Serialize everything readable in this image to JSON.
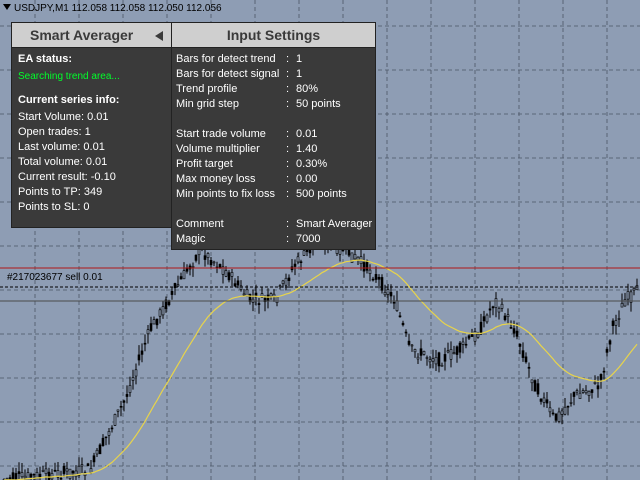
{
  "chart": {
    "symbol_header": "USDJPY,M1  112.058 112.058 112.050 112.056",
    "order_label": "#217023677 sell 0.01",
    "colors": {
      "background": "#8e9db4",
      "grid": "#4b5566",
      "candle": "#000000",
      "moving_average": "#e8d44a",
      "order_line": "#b01818"
    }
  },
  "ea_panel": {
    "title": "Smart Averager",
    "collapse_icon": "triangle-left-icon",
    "status_heading": "EA status:",
    "status_text": "Searching trend area...",
    "series_heading": "Current series info:",
    "lines": [
      "Start Volume: 0.01",
      "Open trades: 1",
      "Last volume: 0.01",
      "Total volume: 0.01",
      "Current result: -0.10",
      "Points to TP: 349",
      "Points to SL: 0"
    ]
  },
  "input_panel": {
    "title": "Input Settings",
    "settings": [
      {
        "label": "Bars for detect trend",
        "value": "1"
      },
      {
        "label": "Bars for detect signal",
        "value": "1"
      },
      {
        "label": "Trend profile",
        "value": "80%"
      },
      {
        "label": "Min grid step",
        "value": "50 points"
      },
      {
        "label": "",
        "value": ""
      },
      {
        "label": "Start trade volume",
        "value": "0.01"
      },
      {
        "label": "Volume multiplier",
        "value": "1.40"
      },
      {
        "label": "Profit target",
        "value": "0.30%"
      },
      {
        "label": "Max money loss",
        "value": "0.00"
      },
      {
        "label": "Min points to fix loss",
        "value": "500 points"
      },
      {
        "label": "",
        "value": ""
      },
      {
        "label": "Comment",
        "value": "Smart Averager"
      },
      {
        "label": "Magic",
        "value": "7000"
      }
    ]
  }
}
